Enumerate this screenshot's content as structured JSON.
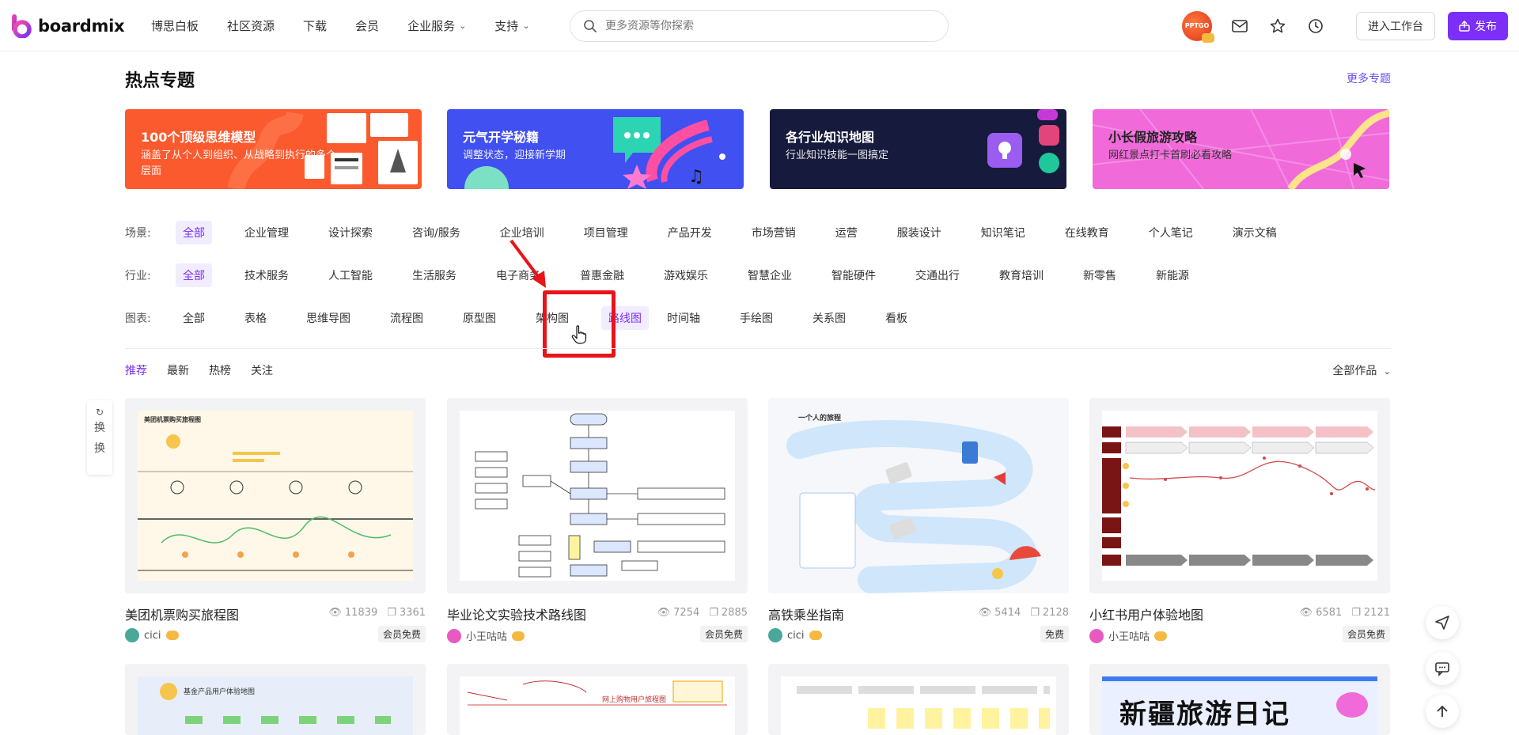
{
  "brand": {
    "name": "boardmix"
  },
  "nav": {
    "items": [
      "博思白板",
      "社区资源",
      "下载",
      "会员",
      "企业服务",
      "支持"
    ]
  },
  "search": {
    "placeholder": "更多资源等你探索"
  },
  "header_tools": {
    "avatar_text": "PPTGO",
    "workspace_label": "进入工作台",
    "publish_label": "发布"
  },
  "section": {
    "title": "热点专题",
    "more": "更多专题"
  },
  "banners": [
    {
      "title": "100个顶级思维模型",
      "subtitle": "涵盖了从个人到组织、从战略到执行的多个层面",
      "color": "#fb5a2e"
    },
    {
      "title": "元气开学秘籍",
      "subtitle": "调整状态，迎接新学期",
      "color": "#4150f0"
    },
    {
      "title": "各行业知识地图",
      "subtitle": "行业知识技能一图搞定",
      "color": "#161a3c"
    },
    {
      "title": "小长假旅游攻略",
      "subtitle": "网红景点打卡首刷必看攻略",
      "color": "#f06ad9"
    }
  ],
  "filters": {
    "scene": {
      "label": "场景:",
      "chips": [
        "全部",
        "企业管理",
        "设计探索",
        "咨询/服务",
        "企业培训",
        "项目管理",
        "产品开发",
        "市场营销",
        "运营",
        "服装设计",
        "知识笔记",
        "在线教育",
        "个人笔记",
        "演示文稿"
      ]
    },
    "industry": {
      "label": "行业:",
      "chips": [
        "全部",
        "技术服务",
        "人工智能",
        "生活服务",
        "电子商务",
        "普惠金融",
        "游戏娱乐",
        "智慧企业",
        "智能硬件",
        "交通出行",
        "教育培训",
        "新零售",
        "新能源"
      ]
    },
    "chart": {
      "label": "图表:",
      "chips": [
        "全部",
        "表格",
        "思维导图",
        "流程图",
        "原型图",
        "架构图",
        "路线图",
        "时间轴",
        "手绘图",
        "关系图",
        "看板"
      ]
    }
  },
  "sort_tabs": [
    "推荐",
    "最新",
    "热榜",
    "关注"
  ],
  "all_works": "全部作品",
  "refresh": {
    "line1": "换",
    "line2": "换"
  },
  "cards": [
    {
      "title": "美团机票购买旅程图",
      "views": "11839",
      "copies": "3361",
      "author": "cici",
      "tag": "会员免费",
      "avatar_color": "#4aa89a"
    },
    {
      "title": "毕业论文实验技术路线图",
      "views": "7254",
      "copies": "2885",
      "author": "小王咕咕",
      "tag": "会员免费",
      "avatar_color": "#e85ac0"
    },
    {
      "title": "高铁乘坐指南",
      "views": "5414",
      "copies": "2128",
      "author": "cici",
      "tag": "免费",
      "avatar_color": "#4aa89a"
    },
    {
      "title": "小红书用户体验地图",
      "views": "6581",
      "copies": "2121",
      "author": "小王咕咕",
      "tag": "会员免费",
      "avatar_color": "#e85ac0"
    }
  ],
  "thumb_text": {
    "card1": "美团机票购买旅程图",
    "card3": "一个人的旅程",
    "row2_1": "基金产品用户体验地图",
    "row2_2": "网上购物用户旅程图",
    "row2_4": "新疆旅游日记"
  },
  "colors": {
    "accent": "#7b2ff7",
    "highlight": "#e8141a"
  }
}
